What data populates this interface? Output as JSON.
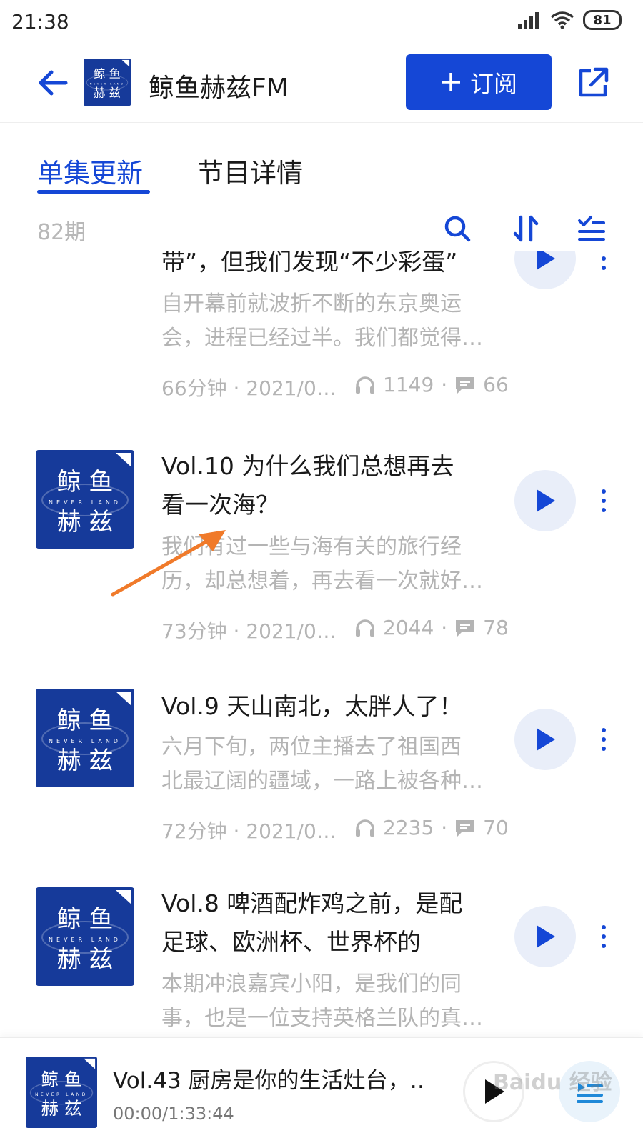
{
  "status_bar": {
    "time": "21:38",
    "battery": "81"
  },
  "header": {
    "title": "鲸鱼赫兹FM",
    "subscribe_label": "订阅",
    "cover_alt": "鲸鱼赫兹"
  },
  "tabs": [
    {
      "label": "单集更新",
      "active": true
    },
    {
      "label": "节目详情",
      "active": false
    }
  ],
  "toolbar": {
    "count": "82期"
  },
  "cover": {
    "line1": "鲸 鱼",
    "line2": "赫 兹",
    "sub": "NEVER LAND"
  },
  "episodes": [
    {
      "title_lines": [
        "带”，但我们发现“不少彩蛋”"
      ],
      "desc_lines": [
        "自开幕前就波折不断的东京奥运",
        "会，进程已经过半。我们都觉得…"
      ],
      "duration_date": "66分钟 · 2021/0…",
      "plays": "1149",
      "comments": "66"
    },
    {
      "title_lines": [
        "Vol.10 为什么我们总想再去",
        "看一次海？"
      ],
      "desc_lines": [
        "我们有过一些与海有关的旅行经",
        "历，却总想着，再去看一次就好…"
      ],
      "duration_date": "73分钟 · 2021/0…",
      "plays": "2044",
      "comments": "78"
    },
    {
      "title_lines": [
        "Vol.9 天山南北，太胖人了！"
      ],
      "desc_lines": [
        "六月下旬，两位主播去了祖国西",
        "北最辽阔的疆域，一路上被各种…"
      ],
      "duration_date": "72分钟 · 2021/0…",
      "plays": "2235",
      "comments": "70"
    },
    {
      "title_lines": [
        "Vol.8 啤酒配炸鸡之前，是配",
        "足球、欧洲杯、世界杯的"
      ],
      "desc_lines": [
        "本期冲浪嘉宾小阳，是我们的同",
        "事，也是一位支持英格兰队的真…"
      ],
      "duration_date": "",
      "plays": "",
      "comments": ""
    }
  ],
  "player": {
    "title": "Vol.43 厨房是你的生活灶台，…",
    "time": "00:00/1:33:44"
  },
  "watermark": "Baidu 经验",
  "colors": {
    "accent": "#1547d6",
    "cover_bg": "#163a9a",
    "muted": "#b4b4b4"
  }
}
